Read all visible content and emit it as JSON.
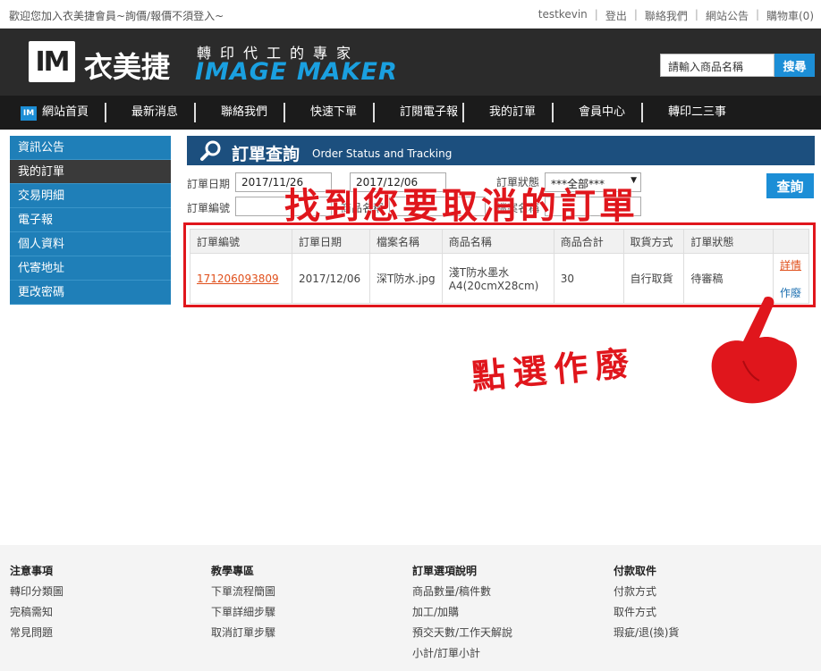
{
  "topbar": {
    "welcome": "歡迎您加入衣美捷會員~詢價/報價不須登入~",
    "links": [
      "testkevin",
      "登出",
      "聯絡我們",
      "網站公告",
      "購物車(0)"
    ]
  },
  "header": {
    "logo_text": "IM",
    "brand_cn": "衣美捷",
    "slogan": "轉印代工的專家",
    "brand_en": "IMAGE MAKER",
    "search_placeholder": "請輸入商品名稱",
    "search_button": "搜尋"
  },
  "nav": {
    "logo_text": "IM",
    "items": [
      "網站首頁",
      "最新消息",
      "聯絡我們",
      "快速下單",
      "訂閱電子報",
      "我的訂單",
      "會員中心",
      "轉印二三事"
    ]
  },
  "sidebar": {
    "items": [
      "資訊公告",
      "我的訂單",
      "交易明細",
      "電子報",
      "個人資料",
      "代寄地址",
      "更改密碼"
    ],
    "active_index": 1
  },
  "panel": {
    "title": "訂單查詢",
    "subtitle": "Order Status and Tracking"
  },
  "filters": {
    "date_label": "訂單日期",
    "date_from": "2017/11/26",
    "date_to": "2017/12/06",
    "status_label": "訂單狀態",
    "status_value": "***全部***",
    "order_no_label": "訂單編號",
    "product_label": "商品名稱",
    "file_label": "檔案名稱",
    "query_button": "查詢"
  },
  "annotations": {
    "main": "找到您要取消的訂單",
    "click": "點選作廢"
  },
  "table": {
    "headers": [
      "訂單編號",
      "訂單日期",
      "檔案名稱",
      "商品名稱",
      "商品合計",
      "取貨方式",
      "訂單狀態"
    ],
    "rows": [
      {
        "order_no": "171206093809",
        "date": "2017/12/06",
        "file": "深T防水.jpg",
        "product": "淺T防水墨水A4(20cmX28cm)",
        "total": "30",
        "pickup": "自行取貨",
        "status": "待審稿",
        "action_detail": "詳情",
        "action_void": "作廢"
      }
    ]
  },
  "footer": {
    "columns": [
      {
        "heading": "注意事項",
        "links": [
          "轉印分類圖",
          "完稿需知",
          "常見問題"
        ]
      },
      {
        "heading": "教學專區",
        "links": [
          "下單流程簡圖",
          "下單詳細步驟",
          "取消訂單步驟"
        ]
      },
      {
        "heading": "訂單選項說明",
        "links": [
          "商品數量/稿件數",
          "加工/加購",
          "預交天數/工作天解說",
          "小計/訂單小計"
        ]
      },
      {
        "heading": "付款取件",
        "links": [
          "付款方式",
          "取件方式",
          "瑕疵/退(換)貨"
        ]
      }
    ]
  },
  "colors": {
    "accent_blue": "#1c8ed6",
    "annotation_red": "#e0161c",
    "header_dark": "#2b2b2b"
  }
}
